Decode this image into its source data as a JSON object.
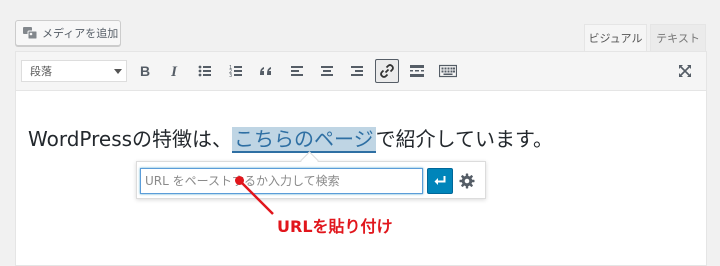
{
  "toolbar_top": {
    "add_media_label": "メディアを追加",
    "tabs": [
      {
        "label": "ビジュアル",
        "active": true
      },
      {
        "label": "テキスト",
        "active": false
      }
    ]
  },
  "editor_toolbar": {
    "format_select_value": "段落",
    "buttons": [
      "bold",
      "italic",
      "bullet-list",
      "numbered-list",
      "blockquote",
      "align-left",
      "align-center",
      "align-right",
      "insert-link",
      "read-more",
      "toolbar-toggle",
      "fullscreen"
    ]
  },
  "content": {
    "text_before": "WordPressの特徴は、",
    "link_text": "こちらのページ",
    "text_after": "で紹介しています。"
  },
  "link_popover": {
    "url_placeholder": "URL をペーストするか入力して検索",
    "url_value": ""
  },
  "annotation": {
    "label": "URLを貼り付け",
    "color": "#e1161c"
  },
  "colors": {
    "accent": "#0085ba",
    "link_highlight": "#bfd5e4",
    "link_text": "#2e6fa3"
  }
}
